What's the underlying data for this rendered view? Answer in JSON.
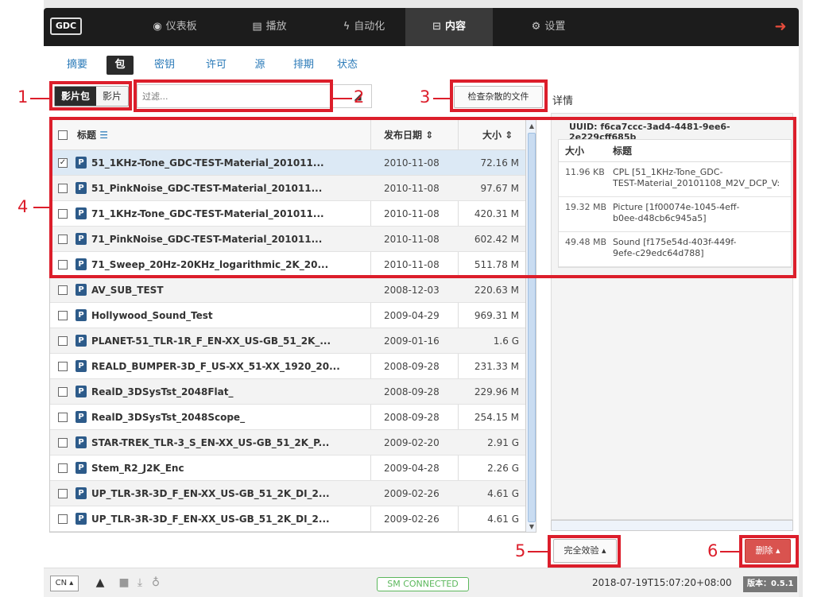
{
  "nav": {
    "logo": "GDC",
    "items": [
      {
        "label": "仪表板",
        "icon": "dashboard-icon",
        "glyph": "◉"
      },
      {
        "label": "播放",
        "icon": "film-icon",
        "glyph": "▤"
      },
      {
        "label": "自动化",
        "icon": "bolt-icon",
        "glyph": "ϟ"
      },
      {
        "label": "内容",
        "icon": "drive-icon",
        "glyph": "⊟",
        "active": true
      },
      {
        "label": "设置",
        "icon": "gears-icon",
        "glyph": "⚙"
      }
    ],
    "logout_glyph": "➜"
  },
  "subtabs": [
    "摘要",
    "包",
    "密钥",
    "许可",
    "源",
    "排期",
    "状态"
  ],
  "subtab_active": "包",
  "toggle": {
    "left": "影片包",
    "right": "影片"
  },
  "filter": {
    "placeholder": "过滤...",
    "clear_glyph": "◢"
  },
  "check_loose_button": "检查杂散的文件",
  "details_label": "详情",
  "table": {
    "col_title": "标题",
    "col_title_icon": "☰",
    "col_date": "发布日期",
    "col_size": "大小",
    "sort_glyph": "⇕",
    "rows": [
      {
        "title": "51_1KHz-Tone_GDC-TEST-Material_201011...",
        "date": "2010-11-08",
        "size": "72.16 M",
        "checked": true
      },
      {
        "title": "51_PinkNoise_GDC-TEST-Material_201011...",
        "date": "2010-11-08",
        "size": "97.67 M"
      },
      {
        "title": "71_1KHz-Tone_GDC-TEST-Material_201011...",
        "date": "2010-11-08",
        "size": "420.31 M"
      },
      {
        "title": "71_PinkNoise_GDC-TEST-Material_201011...",
        "date": "2010-11-08",
        "size": "602.42 M"
      },
      {
        "title": "71_Sweep_20Hz-20KHz_logarithmic_2K_20...",
        "date": "2010-11-08",
        "size": "511.78 M"
      },
      {
        "title": "AV_SUB_TEST",
        "date": "2008-12-03",
        "size": "220.63 M"
      },
      {
        "title": "Hollywood_Sound_Test",
        "date": "2009-04-29",
        "size": "969.31 M"
      },
      {
        "title": "PLANET-51_TLR-1R_F_EN-XX_US-GB_51_2K_...",
        "date": "2009-01-16",
        "size": "1.6 G"
      },
      {
        "title": "REALD_BUMPER-3D_F_US-XX_51-XX_1920_20...",
        "date": "2008-09-28",
        "size": "231.33 M"
      },
      {
        "title": "RealD_3DSysTst_2048Flat_",
        "date": "2008-09-28",
        "size": "229.96 M"
      },
      {
        "title": "RealD_3DSysTst_2048Scope_",
        "date": "2008-09-28",
        "size": "254.15 M"
      },
      {
        "title": "STAR-TREK_TLR-3_S_EN-XX_US-GB_51_2K_P...",
        "date": "2009-02-20",
        "size": "2.91 G"
      },
      {
        "title": "Stem_R2_J2K_Enc",
        "date": "2009-04-28",
        "size": "2.26 G"
      },
      {
        "title": "UP_TLR-3R-3D_F_EN-XX_US-GB_51_2K_DI_2...",
        "date": "2009-02-26",
        "size": "4.61 G"
      },
      {
        "title": "UP_TLR-3R-3D_F_EN-XX_US-GB_51_2K_DI_2...",
        "date": "2009-02-26",
        "size": "4.61 G"
      }
    ],
    "badge": "P",
    "check_mark": "✓"
  },
  "details": {
    "uuid": "UUID: f6ca7ccc-3ad4-4481-9ee6-2e229cff685b",
    "col_size": "大小",
    "col_title": "标题",
    "rows": [
      {
        "size": "11.96 KB",
        "line1": "CPL [51_1KHz-Tone_GDC-",
        "line2": "TEST-Material_20101108_M2V_DCP_V:"
      },
      {
        "size": "19.32 MB",
        "line1": "Picture [1f00074e-1045-4eff-",
        "line2": "b0ee-d48cb6c945a5]"
      },
      {
        "size": "49.48 MB",
        "line1": "Sound [f175e54d-403f-449f-",
        "line2": "9efe-c29edc64d788]"
      }
    ]
  },
  "buttons": {
    "full_verify": "完全效验 ▴",
    "delete": "删除 ▴"
  },
  "annotations": [
    "1",
    "2",
    "3",
    "4",
    "5",
    "6"
  ],
  "footer": {
    "lang": "CN ▴",
    "user_glyph": "▲",
    "camera_glyph": "■",
    "download_glyph": "⤓",
    "stethoscope_glyph": "♁",
    "sm_status": "SM CONNECTED",
    "timestamp": "2018-07-19T15:07:20+08:00",
    "version": "版本：0.5.1"
  },
  "colors": {
    "accent_red": "#dc1e2b",
    "delete_button": "#d9534f",
    "link_blue": "#2a7ab8",
    "badge_blue": "#2d5b8a",
    "sm_green": "#5cb85c"
  }
}
